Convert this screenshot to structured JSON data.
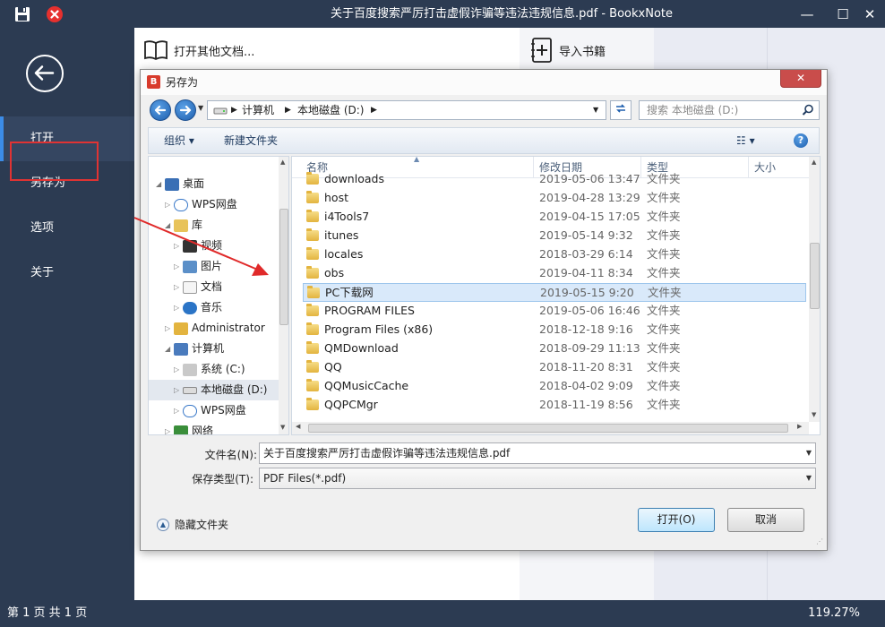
{
  "app": {
    "title": "关于百度搜索严厉打击虚假诈骗等违法违规信息.pdf - BookxNote",
    "controls": {
      "minimize": "—",
      "maximize": "☐",
      "close": "✕"
    }
  },
  "sidebar": {
    "items": [
      {
        "label": "打开"
      },
      {
        "label": "另存为"
      },
      {
        "label": "选项"
      },
      {
        "label": "关于"
      }
    ]
  },
  "toolbar": {
    "open_other": "打开其他文档...",
    "import_books": "导入书籍"
  },
  "status": {
    "page": "第 1 页 共 1 页",
    "zoom": "119.27%"
  },
  "dialog": {
    "title": "另存为",
    "close_label": "✕",
    "address": [
      "计算机",
      "本地磁盘 (D:)"
    ],
    "search_placeholder": "搜索 本地磁盘 (D:)",
    "toolbar": {
      "organize": "组织 ▾",
      "new_folder": "新建文件夹",
      "view": "☷ ▾",
      "help": "?"
    },
    "tree": [
      {
        "label": "桌面",
        "icon": "desktop-icon"
      },
      {
        "label": "WPS网盘",
        "icon": "cloud-icon"
      },
      {
        "label": "库",
        "icon": "library-icon"
      },
      {
        "label": "视频",
        "icon": "video-icon"
      },
      {
        "label": "图片",
        "icon": "picture-icon"
      },
      {
        "label": "文档",
        "icon": "document-icon"
      },
      {
        "label": "音乐",
        "icon": "music-icon"
      },
      {
        "label": "Administrator",
        "icon": "user-icon"
      },
      {
        "label": "计算机",
        "icon": "computer-icon"
      },
      {
        "label": "系统 (C:)",
        "icon": "system-drive-icon"
      },
      {
        "label": "本地磁盘 (D:)",
        "icon": "drive-icon"
      },
      {
        "label": "WPS网盘",
        "icon": "cloud-icon"
      },
      {
        "label": "网络",
        "icon": "network-icon"
      }
    ],
    "columns": {
      "name": "名称",
      "date": "修改日期",
      "type": "类型",
      "size": "大小"
    },
    "files": [
      {
        "name": "downloads",
        "date": "2019-05-06 13:47",
        "type": "文件夹"
      },
      {
        "name": "host",
        "date": "2019-04-28 13:29",
        "type": "文件夹"
      },
      {
        "name": "i4Tools7",
        "date": "2019-04-15 17:05",
        "type": "文件夹"
      },
      {
        "name": "itunes",
        "date": "2019-05-14 9:32",
        "type": "文件夹"
      },
      {
        "name": "locales",
        "date": "2018-03-29 6:14",
        "type": "文件夹"
      },
      {
        "name": "obs",
        "date": "2019-04-11 8:34",
        "type": "文件夹"
      },
      {
        "name": "PC下载网",
        "date": "2019-05-15 9:20",
        "type": "文件夹"
      },
      {
        "name": "PROGRAM FILES",
        "date": "2019-05-06 16:46",
        "type": "文件夹"
      },
      {
        "name": "Program Files (x86)",
        "date": "2018-12-18 9:16",
        "type": "文件夹"
      },
      {
        "name": "QMDownload",
        "date": "2018-09-29 11:13",
        "type": "文件夹"
      },
      {
        "name": "QQ",
        "date": "2018-11-20 8:31",
        "type": "文件夹"
      },
      {
        "name": "QQMusicCache",
        "date": "2018-04-02 9:09",
        "type": "文件夹"
      },
      {
        "name": "QQPCMgr",
        "date": "2018-11-19 8:56",
        "type": "文件夹"
      }
    ],
    "filename_label": "文件名(N):",
    "filename_value": "关于百度搜索严厉打击虚假诈骗等违法违规信息.pdf",
    "filetype_label": "保存类型(T):",
    "filetype_value": "PDF Files(*.pdf)",
    "hide_folders": "隐藏文件夹",
    "open_button": "打开(O)",
    "cancel_button": "取消"
  },
  "colors": {
    "sidebar_bg": "#2c3b52",
    "accent": "#3c8ce7",
    "highlight_box": "#e03333",
    "selection": "#d9e9fa"
  }
}
